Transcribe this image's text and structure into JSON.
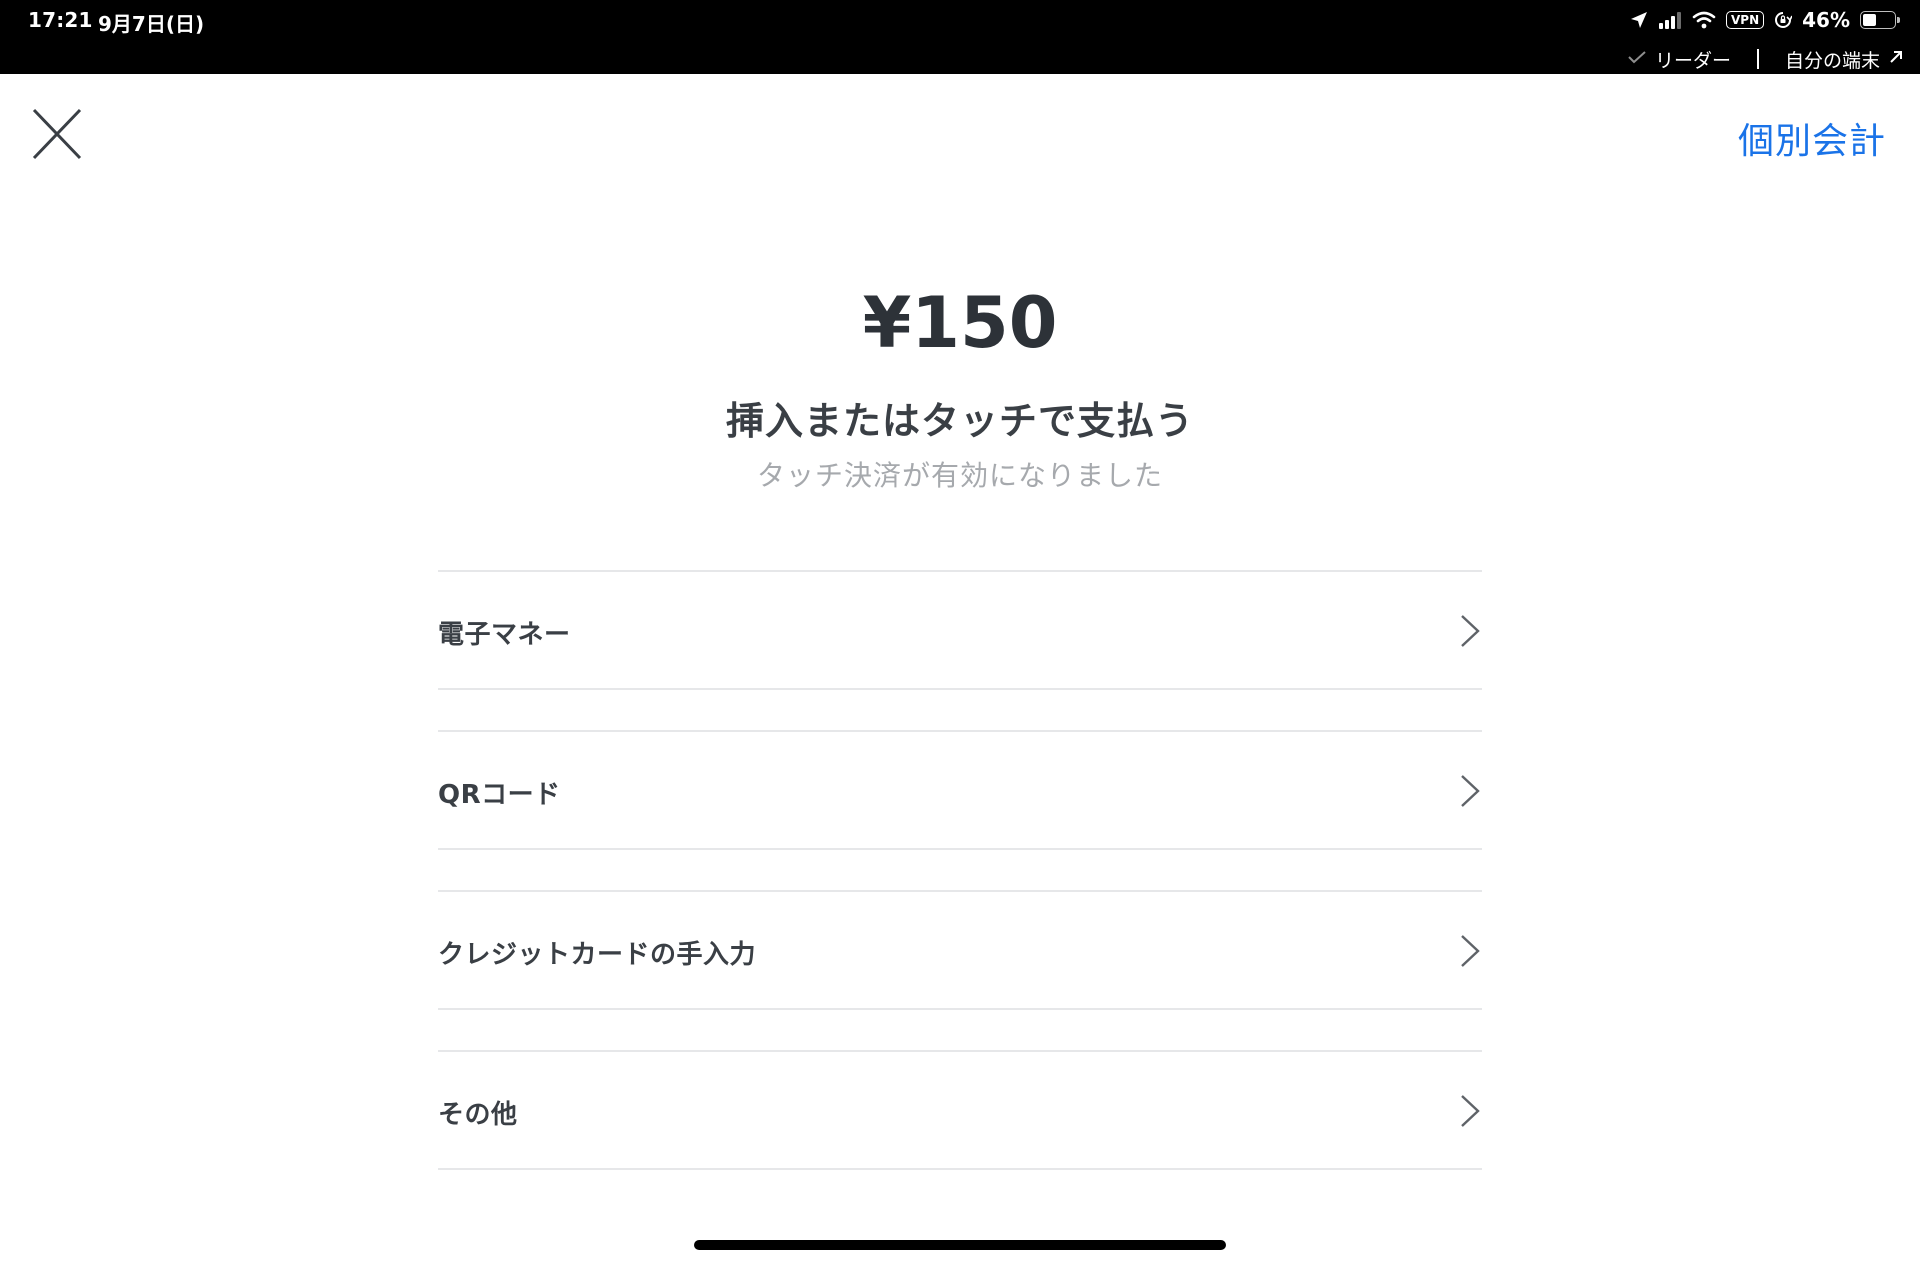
{
  "status_bar": {
    "time": "17:21",
    "date": "9月7日(日)",
    "vpn": "VPN",
    "battery_percent": "46%",
    "battery_level": 0.46,
    "reader_label": "リーダー",
    "device_label": "自分の端末"
  },
  "header": {
    "split_bill_label": "個別会計"
  },
  "payment": {
    "amount": "¥150",
    "prompt": "挿入またはタッチで支払う",
    "subprompt": "タッチ決済が有効になりました"
  },
  "options": [
    {
      "label": "電子マネー"
    },
    {
      "label": "QRコード"
    },
    {
      "label": "クレジットカードの手入力"
    },
    {
      "label": "その他"
    }
  ],
  "colors": {
    "accent": "#1a73e8",
    "text": "#3a3f45",
    "muted": "#a6a9ad",
    "divider": "#e6e7e9"
  }
}
